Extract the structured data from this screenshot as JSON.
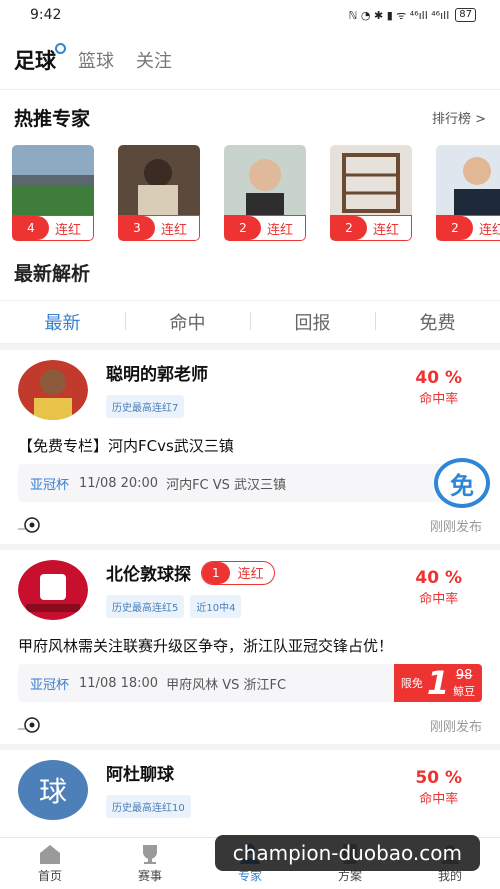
{
  "status": {
    "time": "9:42",
    "icons": "ℕ ◔ ✱ ▮ ᯤ ⁴⁶ıll ⁴⁶ıll",
    "battery": "87"
  },
  "top_tabs": [
    {
      "label": "足球"
    },
    {
      "label": "篮球"
    },
    {
      "label": "关注"
    }
  ],
  "hot_experts": {
    "title": "热推专家",
    "more": "排行榜 >",
    "items": [
      {
        "streak": "4",
        "label": "连红",
        "color": "#6b8fa8"
      },
      {
        "streak": "3",
        "label": "连红",
        "color": "#8a7560"
      },
      {
        "streak": "2",
        "label": "连红",
        "color": "#b9a28c"
      },
      {
        "streak": "2",
        "label": "连红",
        "color": "#a08766"
      },
      {
        "streak": "2",
        "label": "连红",
        "color": "#8fa4b8"
      }
    ]
  },
  "latest": {
    "title": "最新解析",
    "tabs": [
      {
        "label": "最新"
      },
      {
        "label": "命中"
      },
      {
        "label": "回报"
      },
      {
        "label": "免费"
      }
    ]
  },
  "posts": [
    {
      "name": "聪明的郭老师",
      "tags": [
        "历史最高连红7"
      ],
      "rate": "40 %",
      "rate_label": "命中率",
      "text": "【免费专栏】河内FCvs武汉三镇",
      "league": "亚冠杯",
      "time": "11/08 20:00",
      "match": "河内FC VS 武汉三镇",
      "badge": "免",
      "posted": "刚刚发布"
    },
    {
      "name": "北伦敦球探",
      "streak": "1",
      "streak_label": "连红",
      "tags": [
        "历史最高连红5",
        "近10中4"
      ],
      "rate": "40 %",
      "rate_label": "命中率",
      "text": "甲府风林需关注联赛升级区争夺，浙江队亚冠交锋占优！",
      "league": "亚冠杯",
      "time": "11/08 18:00",
      "match": "甲府风林 VS 浙江FC",
      "price_now": "1",
      "price_old": "98",
      "price_unit": "鲸豆",
      "price_tag": "限免",
      "posted": "刚刚发布"
    },
    {
      "name": "阿杜聊球",
      "avatar_char": "球",
      "tags": [
        "历史最高连红10"
      ],
      "rate": "50 %",
      "rate_label": "命中率"
    }
  ],
  "bottom_nav": [
    {
      "label": "首页"
    },
    {
      "label": "赛事"
    },
    {
      "label": "专家"
    },
    {
      "label": "方案"
    },
    {
      "label": "我的"
    }
  ],
  "watermark": "champion-duobao.com"
}
